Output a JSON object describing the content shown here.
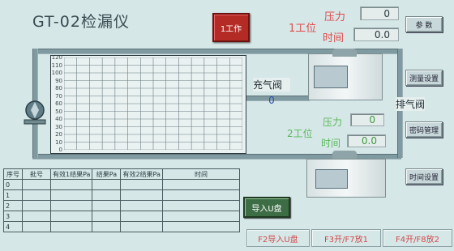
{
  "title": "GT-02检漏仪",
  "station_button": "1工作",
  "station1": {
    "label": "1工位",
    "pressure_label": "压力",
    "pressure_value": "0",
    "time_label": "时间",
    "time_value": "0.0"
  },
  "station2": {
    "label": "2工位",
    "pressure_label": "压力",
    "pressure_value": "0",
    "time_label": "时间",
    "time_value": "0.0"
  },
  "fill_valve": {
    "label": "充气阀",
    "value": "0"
  },
  "exhaust_valve_label": "排气阀",
  "side_buttons": {
    "main": "参 数",
    "measure": "测量设置",
    "password": "密码管理",
    "time": "时间设置"
  },
  "chart_data": {
    "type": "line",
    "yticks": [
      "120",
      "110",
      "100",
      "90",
      "80",
      "70",
      "60",
      "50",
      "40",
      "30",
      "20",
      "10",
      "0"
    ],
    "ylim": [
      0,
      120
    ],
    "series": [],
    "grid": true
  },
  "table": {
    "headers": [
      "序号",
      "批号",
      "有效1结果Pa",
      "结果Pa",
      "有效2结果Pa",
      "时间"
    ],
    "row_index": [
      "0",
      "1",
      "2",
      "3",
      "4"
    ]
  },
  "usb_button": "导入U盘",
  "function_keys": [
    "F2导入U盘",
    "F3开/F7放1",
    "F4开/F8放2"
  ],
  "colors": {
    "background": "#d6e7e8",
    "alarm_red": "#b42a24",
    "usb_green": "#3d6d45"
  }
}
